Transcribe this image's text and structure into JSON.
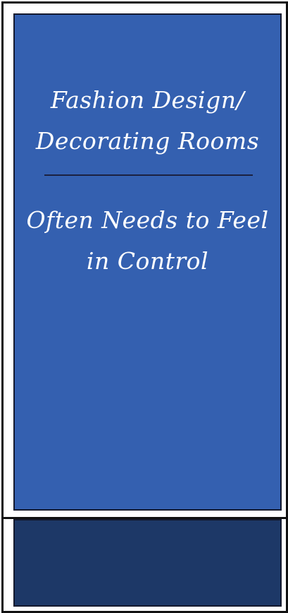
{
  "card": {
    "title_lines": [
      "Fashion Design/",
      "Decorating Rooms"
    ],
    "subtitle_lines": [
      "Often Needs to Feel",
      "in Control"
    ]
  },
  "colors": {
    "main_panel": "#3460b0",
    "bottom_panel": "#1d3867",
    "border": "#111111",
    "text": "#ffffff"
  }
}
